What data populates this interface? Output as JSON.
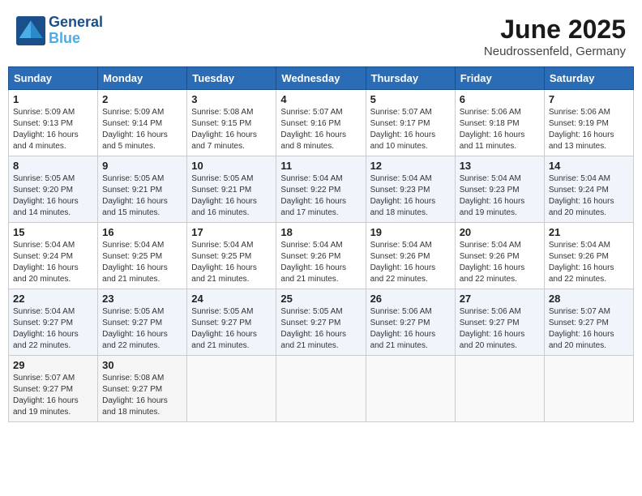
{
  "header": {
    "logo_general": "General",
    "logo_blue": "Blue",
    "month": "June 2025",
    "location": "Neudrossenfeld, Germany"
  },
  "days_of_week": [
    "Sunday",
    "Monday",
    "Tuesday",
    "Wednesday",
    "Thursday",
    "Friday",
    "Saturday"
  ],
  "weeks": [
    [
      {
        "day": "1",
        "sunrise": "Sunrise: 5:09 AM",
        "sunset": "Sunset: 9:13 PM",
        "daylight": "Daylight: 16 hours and 4 minutes."
      },
      {
        "day": "2",
        "sunrise": "Sunrise: 5:09 AM",
        "sunset": "Sunset: 9:14 PM",
        "daylight": "Daylight: 16 hours and 5 minutes."
      },
      {
        "day": "3",
        "sunrise": "Sunrise: 5:08 AM",
        "sunset": "Sunset: 9:15 PM",
        "daylight": "Daylight: 16 hours and 7 minutes."
      },
      {
        "day": "4",
        "sunrise": "Sunrise: 5:07 AM",
        "sunset": "Sunset: 9:16 PM",
        "daylight": "Daylight: 16 hours and 8 minutes."
      },
      {
        "day": "5",
        "sunrise": "Sunrise: 5:07 AM",
        "sunset": "Sunset: 9:17 PM",
        "daylight": "Daylight: 16 hours and 10 minutes."
      },
      {
        "day": "6",
        "sunrise": "Sunrise: 5:06 AM",
        "sunset": "Sunset: 9:18 PM",
        "daylight": "Daylight: 16 hours and 11 minutes."
      },
      {
        "day": "7",
        "sunrise": "Sunrise: 5:06 AM",
        "sunset": "Sunset: 9:19 PM",
        "daylight": "Daylight: 16 hours and 13 minutes."
      }
    ],
    [
      {
        "day": "8",
        "sunrise": "Sunrise: 5:05 AM",
        "sunset": "Sunset: 9:20 PM",
        "daylight": "Daylight: 16 hours and 14 minutes."
      },
      {
        "day": "9",
        "sunrise": "Sunrise: 5:05 AM",
        "sunset": "Sunset: 9:21 PM",
        "daylight": "Daylight: 16 hours and 15 minutes."
      },
      {
        "day": "10",
        "sunrise": "Sunrise: 5:05 AM",
        "sunset": "Sunset: 9:21 PM",
        "daylight": "Daylight: 16 hours and 16 minutes."
      },
      {
        "day": "11",
        "sunrise": "Sunrise: 5:04 AM",
        "sunset": "Sunset: 9:22 PM",
        "daylight": "Daylight: 16 hours and 17 minutes."
      },
      {
        "day": "12",
        "sunrise": "Sunrise: 5:04 AM",
        "sunset": "Sunset: 9:23 PM",
        "daylight": "Daylight: 16 hours and 18 minutes."
      },
      {
        "day": "13",
        "sunrise": "Sunrise: 5:04 AM",
        "sunset": "Sunset: 9:23 PM",
        "daylight": "Daylight: 16 hours and 19 minutes."
      },
      {
        "day": "14",
        "sunrise": "Sunrise: 5:04 AM",
        "sunset": "Sunset: 9:24 PM",
        "daylight": "Daylight: 16 hours and 20 minutes."
      }
    ],
    [
      {
        "day": "15",
        "sunrise": "Sunrise: 5:04 AM",
        "sunset": "Sunset: 9:24 PM",
        "daylight": "Daylight: 16 hours and 20 minutes."
      },
      {
        "day": "16",
        "sunrise": "Sunrise: 5:04 AM",
        "sunset": "Sunset: 9:25 PM",
        "daylight": "Daylight: 16 hours and 21 minutes."
      },
      {
        "day": "17",
        "sunrise": "Sunrise: 5:04 AM",
        "sunset": "Sunset: 9:25 PM",
        "daylight": "Daylight: 16 hours and 21 minutes."
      },
      {
        "day": "18",
        "sunrise": "Sunrise: 5:04 AM",
        "sunset": "Sunset: 9:26 PM",
        "daylight": "Daylight: 16 hours and 21 minutes."
      },
      {
        "day": "19",
        "sunrise": "Sunrise: 5:04 AM",
        "sunset": "Sunset: 9:26 PM",
        "daylight": "Daylight: 16 hours and 22 minutes."
      },
      {
        "day": "20",
        "sunrise": "Sunrise: 5:04 AM",
        "sunset": "Sunset: 9:26 PM",
        "daylight": "Daylight: 16 hours and 22 minutes."
      },
      {
        "day": "21",
        "sunrise": "Sunrise: 5:04 AM",
        "sunset": "Sunset: 9:26 PM",
        "daylight": "Daylight: 16 hours and 22 minutes."
      }
    ],
    [
      {
        "day": "22",
        "sunrise": "Sunrise: 5:04 AM",
        "sunset": "Sunset: 9:27 PM",
        "daylight": "Daylight: 16 hours and 22 minutes."
      },
      {
        "day": "23",
        "sunrise": "Sunrise: 5:05 AM",
        "sunset": "Sunset: 9:27 PM",
        "daylight": "Daylight: 16 hours and 22 minutes."
      },
      {
        "day": "24",
        "sunrise": "Sunrise: 5:05 AM",
        "sunset": "Sunset: 9:27 PM",
        "daylight": "Daylight: 16 hours and 21 minutes."
      },
      {
        "day": "25",
        "sunrise": "Sunrise: 5:05 AM",
        "sunset": "Sunset: 9:27 PM",
        "daylight": "Daylight: 16 hours and 21 minutes."
      },
      {
        "day": "26",
        "sunrise": "Sunrise: 5:06 AM",
        "sunset": "Sunset: 9:27 PM",
        "daylight": "Daylight: 16 hours and 21 minutes."
      },
      {
        "day": "27",
        "sunrise": "Sunrise: 5:06 AM",
        "sunset": "Sunset: 9:27 PM",
        "daylight": "Daylight: 16 hours and 20 minutes."
      },
      {
        "day": "28",
        "sunrise": "Sunrise: 5:07 AM",
        "sunset": "Sunset: 9:27 PM",
        "daylight": "Daylight: 16 hours and 20 minutes."
      }
    ],
    [
      {
        "day": "29",
        "sunrise": "Sunrise: 5:07 AM",
        "sunset": "Sunset: 9:27 PM",
        "daylight": "Daylight: 16 hours and 19 minutes."
      },
      {
        "day": "30",
        "sunrise": "Sunrise: 5:08 AM",
        "sunset": "Sunset: 9:27 PM",
        "daylight": "Daylight: 16 hours and 18 minutes."
      },
      null,
      null,
      null,
      null,
      null
    ]
  ]
}
